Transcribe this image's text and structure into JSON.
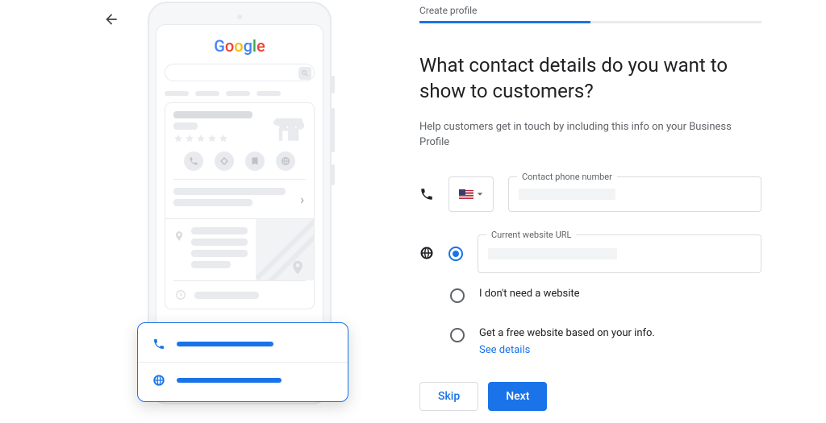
{
  "stepper": {
    "label": "Create profile",
    "progress_pct": 50
  },
  "heading": "What contact details do you want to show to customers?",
  "subheading": "Help customers get in touch by including this info on your Business Profile",
  "phone": {
    "field_label": "Contact phone number",
    "country_code_icon": "us-flag",
    "value": ""
  },
  "website": {
    "selected_option": "url",
    "options": {
      "url": {
        "field_label": "Current website URL",
        "value": ""
      },
      "none": {
        "label": "I don't need a website"
      },
      "free": {
        "label": "Get a free website based on your info.",
        "see_details_label": "See details"
      }
    }
  },
  "buttons": {
    "skip": "Skip",
    "next": "Next"
  },
  "illustration": {
    "logo": [
      "G",
      "o",
      "o",
      "g",
      "l",
      "e"
    ]
  }
}
